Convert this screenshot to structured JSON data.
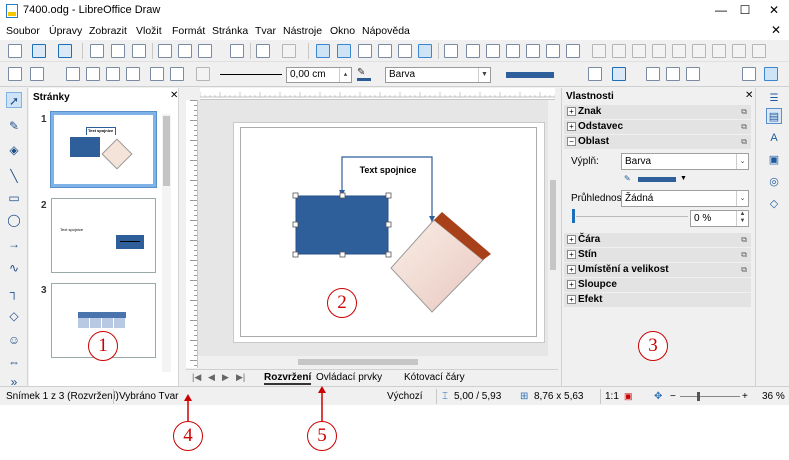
{
  "window": {
    "title": "7400.odg - LibreOffice Draw",
    "min_glyph": "—",
    "max_glyph": "☐",
    "close_glyph": "✕"
  },
  "menu": [
    "Soubor",
    "Úpravy",
    "Zobrazit",
    "Vložit",
    "Formát",
    "Stránka",
    "Tvar",
    "Nástroje",
    "Okno",
    "Nápověda"
  ],
  "line_toolbar": {
    "line_width": "0,00 cm",
    "fill_type": "Barva"
  },
  "pages_panel": {
    "title": "Stránky",
    "page_numbers": [
      "1",
      "2",
      "3"
    ],
    "thumb1_caption": "Text spojnice",
    "thumb2_caption": "Text spojnice"
  },
  "canvas": {
    "connector_text": "Text spojnice"
  },
  "tabs": [
    "Rozvržení",
    "Ovládací prvky",
    "Kótovací čáry"
  ],
  "sidebar": {
    "title": "Vlastnosti",
    "sections_top": [
      "Znak",
      "Odstavec",
      "Oblast"
    ],
    "fill_label": "Výplň:",
    "fill_value": "Barva",
    "transparency_label": "Průhlednost:",
    "transparency_value": "Žádná",
    "transparency_percent": "0 %",
    "sections_bottom": [
      "Čára",
      "Stín",
      "Umístění a velikost",
      "Sloupce",
      "Efekt"
    ]
  },
  "status": {
    "slide": "Snímek 1 z 3 (Rozvržení)",
    "selection": "Vybráno Tvar",
    "layout": "Výchozí",
    "position": "5,00 / 5,93",
    "size": "8,76 x 5,63",
    "scale": "1:1",
    "zoom": "36 %"
  },
  "callouts": [
    "1",
    "2",
    "3",
    "4",
    "5"
  ],
  "colors": {
    "shape_fill": "#2e5f9a",
    "accent": "#c00000",
    "diamond_border": "#a8401a"
  }
}
